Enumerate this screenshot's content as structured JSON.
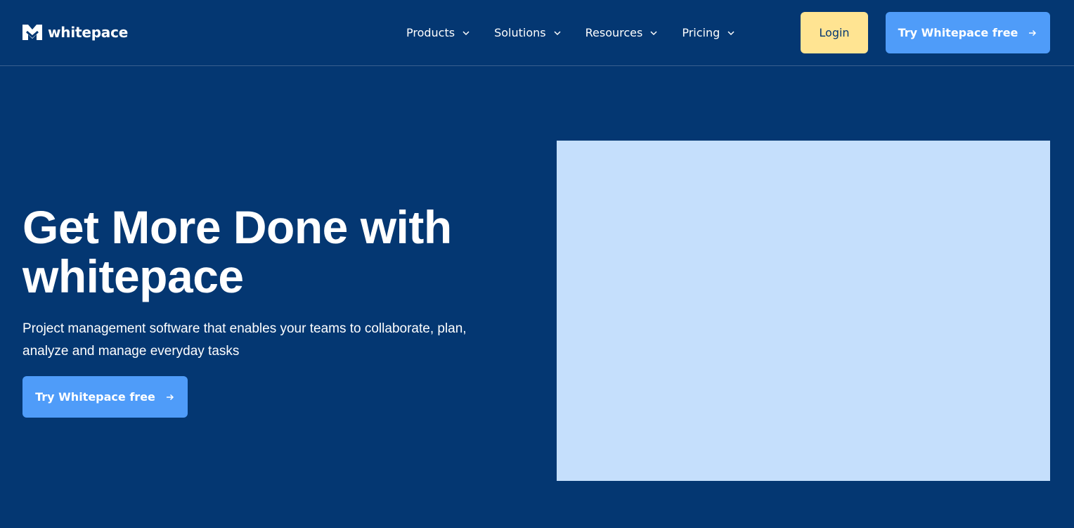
{
  "brand": {
    "name": "whitepace",
    "logo_icon": "whitepace-logo-icon"
  },
  "nav": {
    "items": [
      {
        "label": "Products",
        "icon": "chevron-down-icon"
      },
      {
        "label": "Solutions",
        "icon": "chevron-down-icon"
      },
      {
        "label": "Resources",
        "icon": "chevron-down-icon"
      },
      {
        "label": "Pricing",
        "icon": "chevron-down-icon"
      }
    ]
  },
  "header": {
    "login_label": "Login",
    "cta_label": "Try Whitepace free",
    "cta_icon": "arrow-right-icon"
  },
  "hero": {
    "title_line1": "Get More Done with",
    "title_line2": "whitepace",
    "subtitle_line1": "Project management software that enables your teams to collaborate, plan,",
    "subtitle_line2": "analyze and manage everyday tasks",
    "cta_label": "Try Whitepace free",
    "cta_icon": "arrow-right-icon"
  },
  "colors": {
    "background": "#043772",
    "login_bg": "#ffe492",
    "cta_bg": "#4f9cf9",
    "media_placeholder": "#c5dffc",
    "text": "#ffffff"
  }
}
